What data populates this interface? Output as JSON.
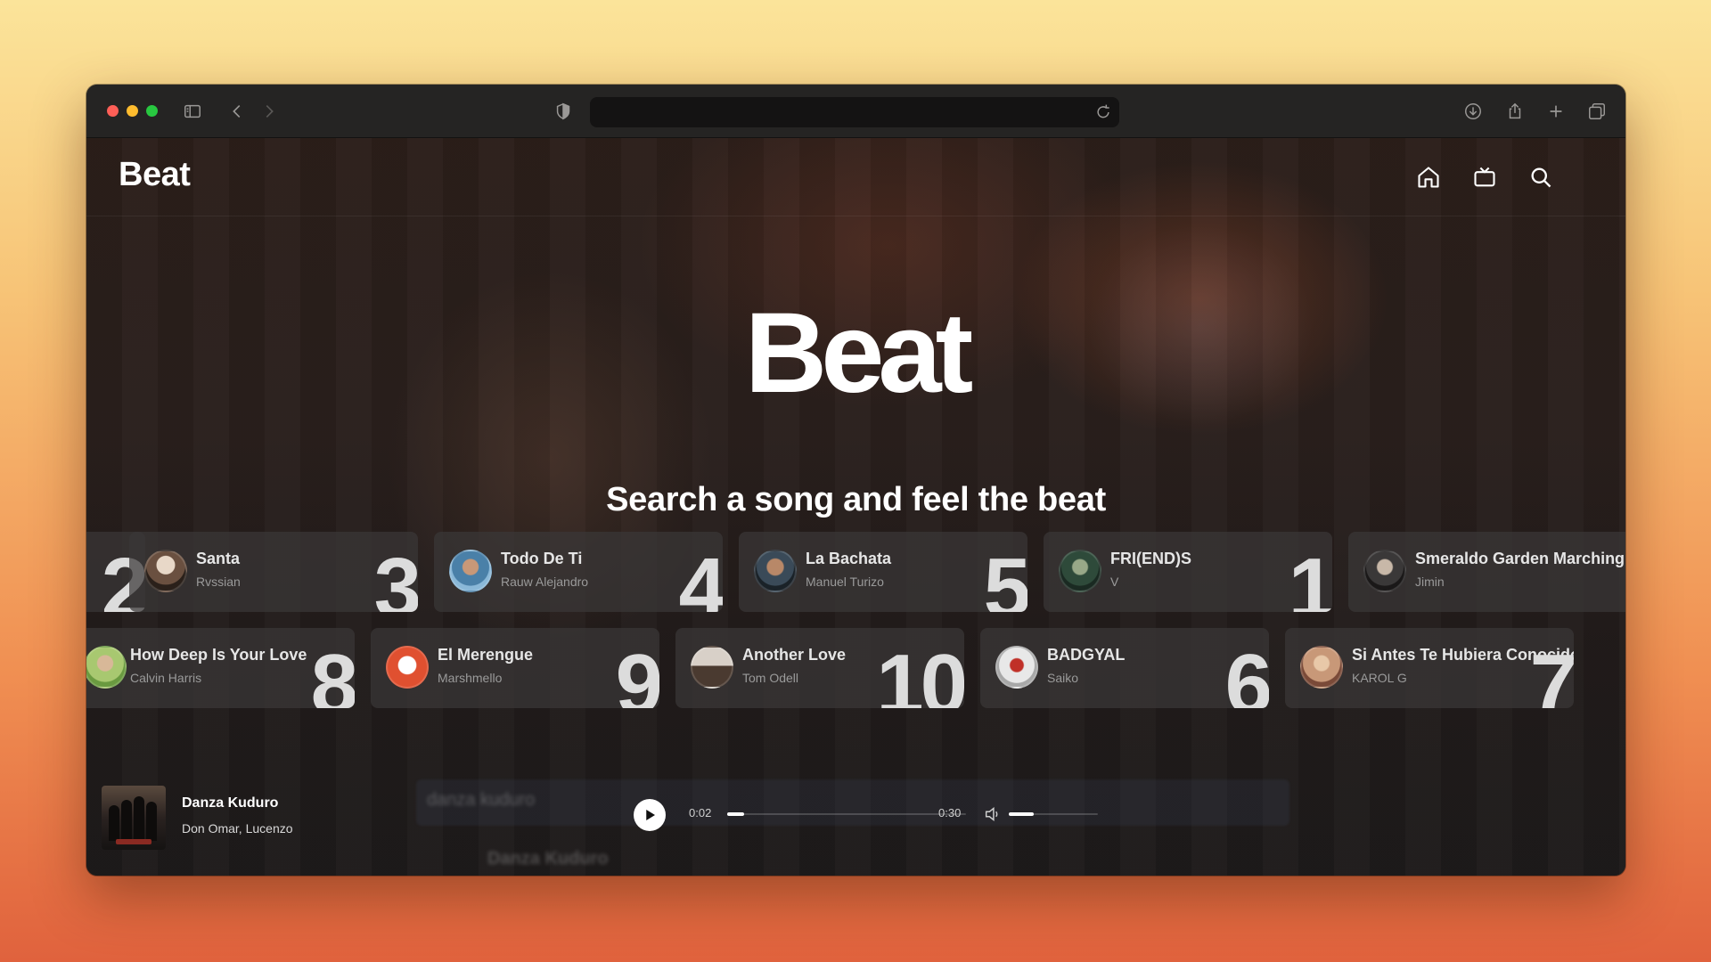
{
  "browser": {
    "address_value": "",
    "icons": [
      "sidebar-icon",
      "back-icon",
      "forward-icon",
      "shield-icon",
      "reload-icon",
      "download-icon",
      "share-icon",
      "new-tab-icon",
      "tabs-overview-icon"
    ]
  },
  "app": {
    "brand": "Beat",
    "nav": [
      "home-icon",
      "tv-icon",
      "search-icon"
    ]
  },
  "hero": {
    "title": "Beat",
    "subtitle": "Search a song and feel the beat"
  },
  "songs_row1": [
    {
      "title": "",
      "artist": "",
      "rank": "2"
    },
    {
      "title": "Santa",
      "artist": "Rvssian",
      "rank": "3"
    },
    {
      "title": "Todo De Ti",
      "artist": "Rauw Alejandro",
      "rank": "4"
    },
    {
      "title": "La Bachata",
      "artist": "Manuel Turizo",
      "rank": "5"
    },
    {
      "title": "FRI(END)S",
      "artist": "V",
      "rank": "1"
    },
    {
      "title": "Smeraldo Garden Marching",
      "artist": "Jimin",
      "rank": ""
    }
  ],
  "songs_row2": [
    {
      "title": "How Deep Is Your Love",
      "artist": "Calvin Harris",
      "rank": "8"
    },
    {
      "title": "El Merengue",
      "artist": "Marshmello",
      "rank": "9"
    },
    {
      "title": "Another Love",
      "artist": "Tom Odell",
      "rank": "10"
    },
    {
      "title": "BADGYAL",
      "artist": "Saiko",
      "rank": "6"
    },
    {
      "title": "Si Antes Te Hubiera Conocido",
      "artist": "KAROL G",
      "rank": "7"
    }
  ],
  "player": {
    "title": "Danza Kuduro",
    "artist": "Don Omar, Lucenzo",
    "current_time": "0:02",
    "duration": "0:30",
    "progress": 0.07,
    "volume": 0.28,
    "ghost_search": "danza kuduro",
    "ghost_result": "Danza Kuduro"
  },
  "colors": {
    "traffic_red": "#fe5f57",
    "traffic_yellow": "#febc2e",
    "traffic_green": "#28c840",
    "card_bg": "#3a3838",
    "text_primary": "#ffffff",
    "text_secondary": "#9a9a9a"
  }
}
